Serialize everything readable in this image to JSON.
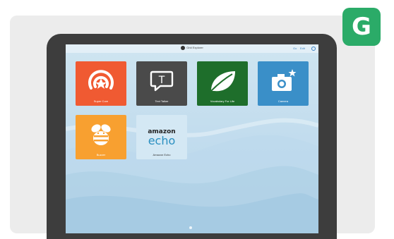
{
  "brand_badge": {
    "letter": "G",
    "color": "#2bab68"
  },
  "app": {
    "title": "Grid Explorer",
    "nav_link_1": "Go",
    "nav_link_2": "Edit"
  },
  "tiles": [
    {
      "label": "Super Core",
      "color": "#f05a32",
      "icon": "broadcast-star-icon"
    },
    {
      "label": "Text Talker",
      "color": "#4a4a4a",
      "icon": "speech-bubble-t-icon"
    },
    {
      "label": "Vocabulary For Life",
      "color": "#1e6e2b",
      "icon": "leaf-icon"
    },
    {
      "label": "Camera",
      "color": "#3a8fc8",
      "icon": "camera-star-icon"
    },
    {
      "label": "Buzzer",
      "color": "#f8a030",
      "icon": "bee-icon"
    },
    {
      "label": "Amazon Echo",
      "color": "#d4e8f4",
      "icon": "amazon-echo-logo"
    }
  ],
  "echo_logo": {
    "line1": "amazon",
    "line2": "echo"
  }
}
